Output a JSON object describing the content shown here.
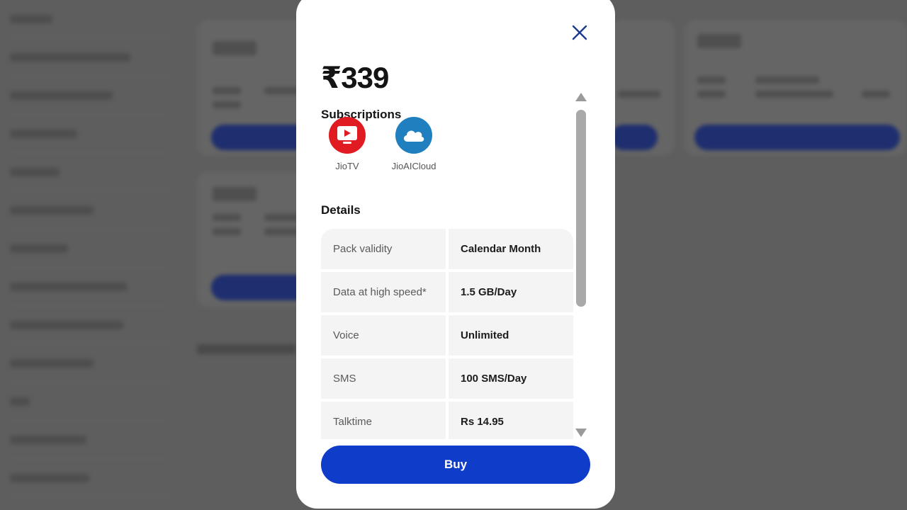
{
  "colors": {
    "accent": "#0f3cc9",
    "jiotv": "#e11b22",
    "jioaicloud": "#1f7fbf",
    "close_icon": "#1c3a8e"
  },
  "modal": {
    "price": "₹339",
    "subscriptions_title": "Subscriptions",
    "subscriptions": [
      {
        "name": "JioTV",
        "icon": "tv-play-icon"
      },
      {
        "name": "JioAICloud",
        "icon": "cloud-icon"
      }
    ],
    "details_title": "Details",
    "details": [
      {
        "label": "Pack validity",
        "value": "Calendar Month"
      },
      {
        "label": "Data at high speed*",
        "value": "1.5 GB/Day"
      },
      {
        "label": "Voice",
        "value": "Unlimited"
      },
      {
        "label": "SMS",
        "value": "100 SMS/Day"
      },
      {
        "label": "Talktime",
        "value": "Rs 14.95"
      }
    ],
    "buy_label": "Buy",
    "close_icon": "close-icon"
  }
}
